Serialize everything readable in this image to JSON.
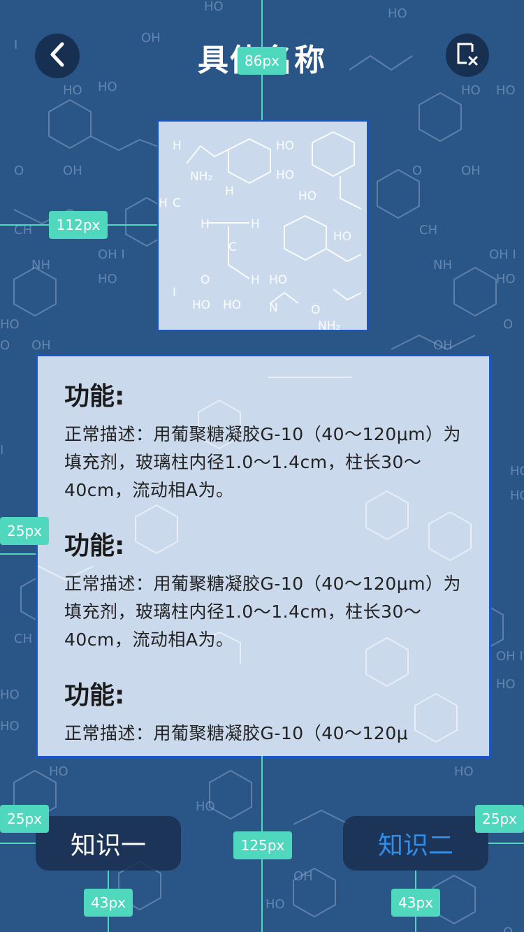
{
  "header": {
    "title": "具体名称",
    "back_icon": "chevron-left-icon",
    "close_icon": "scan-close-icon"
  },
  "card": {
    "sections": [
      {
        "title": "功能:",
        "text": "正常描述：用葡聚糖凝胶G-10（40～120μm）为填充剂，玻璃柱内径1.0～1.4cm，柱长30～40cm，流动相A为。"
      },
      {
        "title": "功能:",
        "text": "正常描述：用葡聚糖凝胶G-10（40～120μm）为填充剂，玻璃柱内径1.0～1.4cm，柱长30～40cm，流动相A为。"
      },
      {
        "title": "功能:",
        "text": "正常描述：用葡聚糖凝胶G-10（40～120μ"
      }
    ]
  },
  "tabs": {
    "tab1": "知识一",
    "tab2": "知识二"
  },
  "guides": {
    "top_label": "86px",
    "left_label": "112px",
    "card_left_label": "25px",
    "tab_left_label": "25px",
    "tab_right_label": "25px",
    "center_label": "125px",
    "tab1_bottom_label": "43px",
    "tab2_bottom_label": "43px"
  },
  "colors": {
    "background": "#2a5587",
    "card": "#cbd9ec",
    "border": "#1a56c9",
    "guide": "#4fd8bd",
    "active_tab": "#2f8ee8"
  }
}
